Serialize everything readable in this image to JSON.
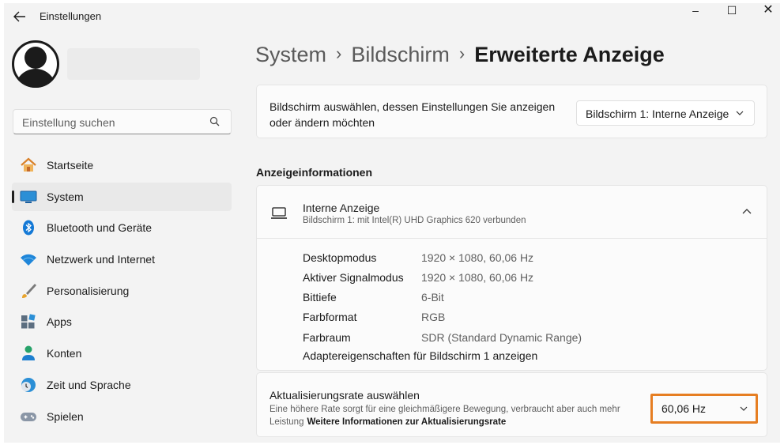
{
  "window": {
    "title": "Einstellungen",
    "back_icon": "arrow-left-icon",
    "controls": {
      "minimize": "–",
      "maximize": "☐",
      "close": "✕"
    }
  },
  "sidebar": {
    "search": {
      "placeholder": "Einstellung suchen",
      "icon": "search-icon"
    },
    "items": [
      {
        "label": "Startseite",
        "icon": "home-icon",
        "active": false
      },
      {
        "label": "System",
        "icon": "monitor-icon",
        "active": true
      },
      {
        "label": "Bluetooth und Geräte",
        "icon": "bluetooth-icon",
        "active": false
      },
      {
        "label": "Netzwerk und Internet",
        "icon": "wifi-icon",
        "active": false
      },
      {
        "label": "Personalisierung",
        "icon": "brush-icon",
        "active": false
      },
      {
        "label": "Apps",
        "icon": "apps-icon",
        "active": false
      },
      {
        "label": "Konten",
        "icon": "person-icon",
        "active": false
      },
      {
        "label": "Zeit und Sprache",
        "icon": "globe-clock-icon",
        "active": false
      },
      {
        "label": "Spielen",
        "icon": "gamepad-icon",
        "active": false
      }
    ]
  },
  "main": {
    "breadcrumb": [
      "System",
      "Bildschirm",
      "Erweiterte Anzeige"
    ],
    "breadcrumb_sep": "›",
    "select_display": {
      "text": "Bildschirm auswählen, dessen Einstellungen Sie anzeigen oder ändern möchten",
      "selected": "Bildschirm 1: Interne Anzeige"
    },
    "section_title": "Anzeigeinformationen",
    "display": {
      "name": "Interne Anzeige",
      "subtitle": "Bildschirm 1: mit Intel(R) UHD Graphics 620 verbunden",
      "rows": [
        {
          "label": "Desktopmodus",
          "value": "1920 × 1080, 60,06 Hz"
        },
        {
          "label": "Aktiver Signalmodus",
          "value": "1920 × 1080, 60,06 Hz"
        },
        {
          "label": "Bittiefe",
          "value": "6-Bit"
        },
        {
          "label": "Farbformat",
          "value": "RGB"
        },
        {
          "label": "Farbraum",
          "value": "SDR (Standard Dynamic Range)"
        }
      ],
      "adapter_link": "Adaptereigenschaften für Bildschirm 1 anzeigen"
    },
    "refresh": {
      "title": "Aktualisierungsrate auswählen",
      "description": "Eine höhere Rate sorgt für eine gleichmäßigere Bewegung, verbraucht aber auch mehr Leistung",
      "link": "Weitere Informationen zur Aktualisierungsrate",
      "selected": "60,06 Hz"
    }
  },
  "colors": {
    "highlight": "#e67e22",
    "accent": "#0067c0"
  }
}
